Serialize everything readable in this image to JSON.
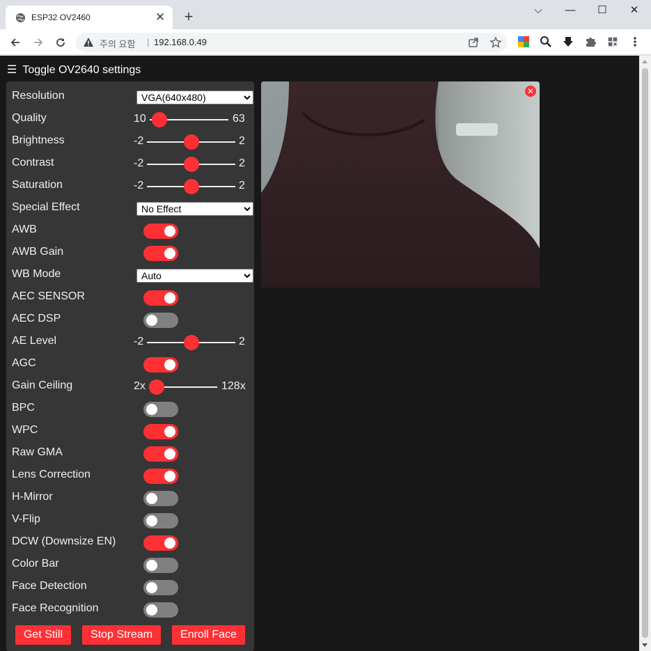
{
  "browser": {
    "tab_title": "ESP32 OV2460",
    "tab_close": "✕",
    "new_tab": "+",
    "security_label": "주의 요함",
    "separator": "|",
    "url": "192.168.0.49",
    "window_minimize": "⌵",
    "window_min": "—",
    "window_max": "☐",
    "window_close": "✕"
  },
  "page": {
    "toggle_icon": "☰",
    "toggle_label": "Toggle OV2640 settings"
  },
  "settings": {
    "resolution": {
      "label": "Resolution",
      "value": "VGA(640x480)"
    },
    "quality": {
      "label": "Quality",
      "min": "10",
      "max": "63",
      "value": 10
    },
    "brightness": {
      "label": "Brightness",
      "min": "-2",
      "max": "2",
      "value": 0
    },
    "contrast": {
      "label": "Contrast",
      "min": "-2",
      "max": "2",
      "value": 0
    },
    "saturation": {
      "label": "Saturation",
      "min": "-2",
      "max": "2",
      "value": 0
    },
    "special_effect": {
      "label": "Special Effect",
      "value": "No Effect"
    },
    "awb": {
      "label": "AWB",
      "on": true
    },
    "awb_gain": {
      "label": "AWB Gain",
      "on": true
    },
    "wb_mode": {
      "label": "WB Mode",
      "value": "Auto"
    },
    "aec_sensor": {
      "label": "AEC SENSOR",
      "on": true
    },
    "aec_dsp": {
      "label": "AEC DSP",
      "on": false
    },
    "ae_level": {
      "label": "AE Level",
      "min": "-2",
      "max": "2",
      "value": 0
    },
    "agc": {
      "label": "AGC",
      "on": true
    },
    "gain_ceiling": {
      "label": "Gain Ceiling",
      "min": "2x",
      "max": "128x",
      "value": 0
    },
    "bpc": {
      "label": "BPC",
      "on": false
    },
    "wpc": {
      "label": "WPC",
      "on": true
    },
    "raw_gma": {
      "label": "Raw GMA",
      "on": true
    },
    "lens_correction": {
      "label": "Lens Correction",
      "on": true
    },
    "h_mirror": {
      "label": "H-Mirror",
      "on": false
    },
    "v_flip": {
      "label": "V-Flip",
      "on": false
    },
    "dcw": {
      "label": "DCW (Downsize EN)",
      "on": true
    },
    "color_bar": {
      "label": "Color Bar",
      "on": false
    },
    "face_detection": {
      "label": "Face Detection",
      "on": false
    },
    "face_recognition": {
      "label": "Face Recognition",
      "on": false
    }
  },
  "buttons": {
    "get_still": "Get Still",
    "stop_stream": "Stop Stream",
    "enroll_face": "Enroll Face"
  },
  "stream": {
    "close": "✕"
  },
  "colors": {
    "accent": "#ff3034",
    "panel": "#363636",
    "background": "#181818",
    "switch_off": "#808080"
  }
}
